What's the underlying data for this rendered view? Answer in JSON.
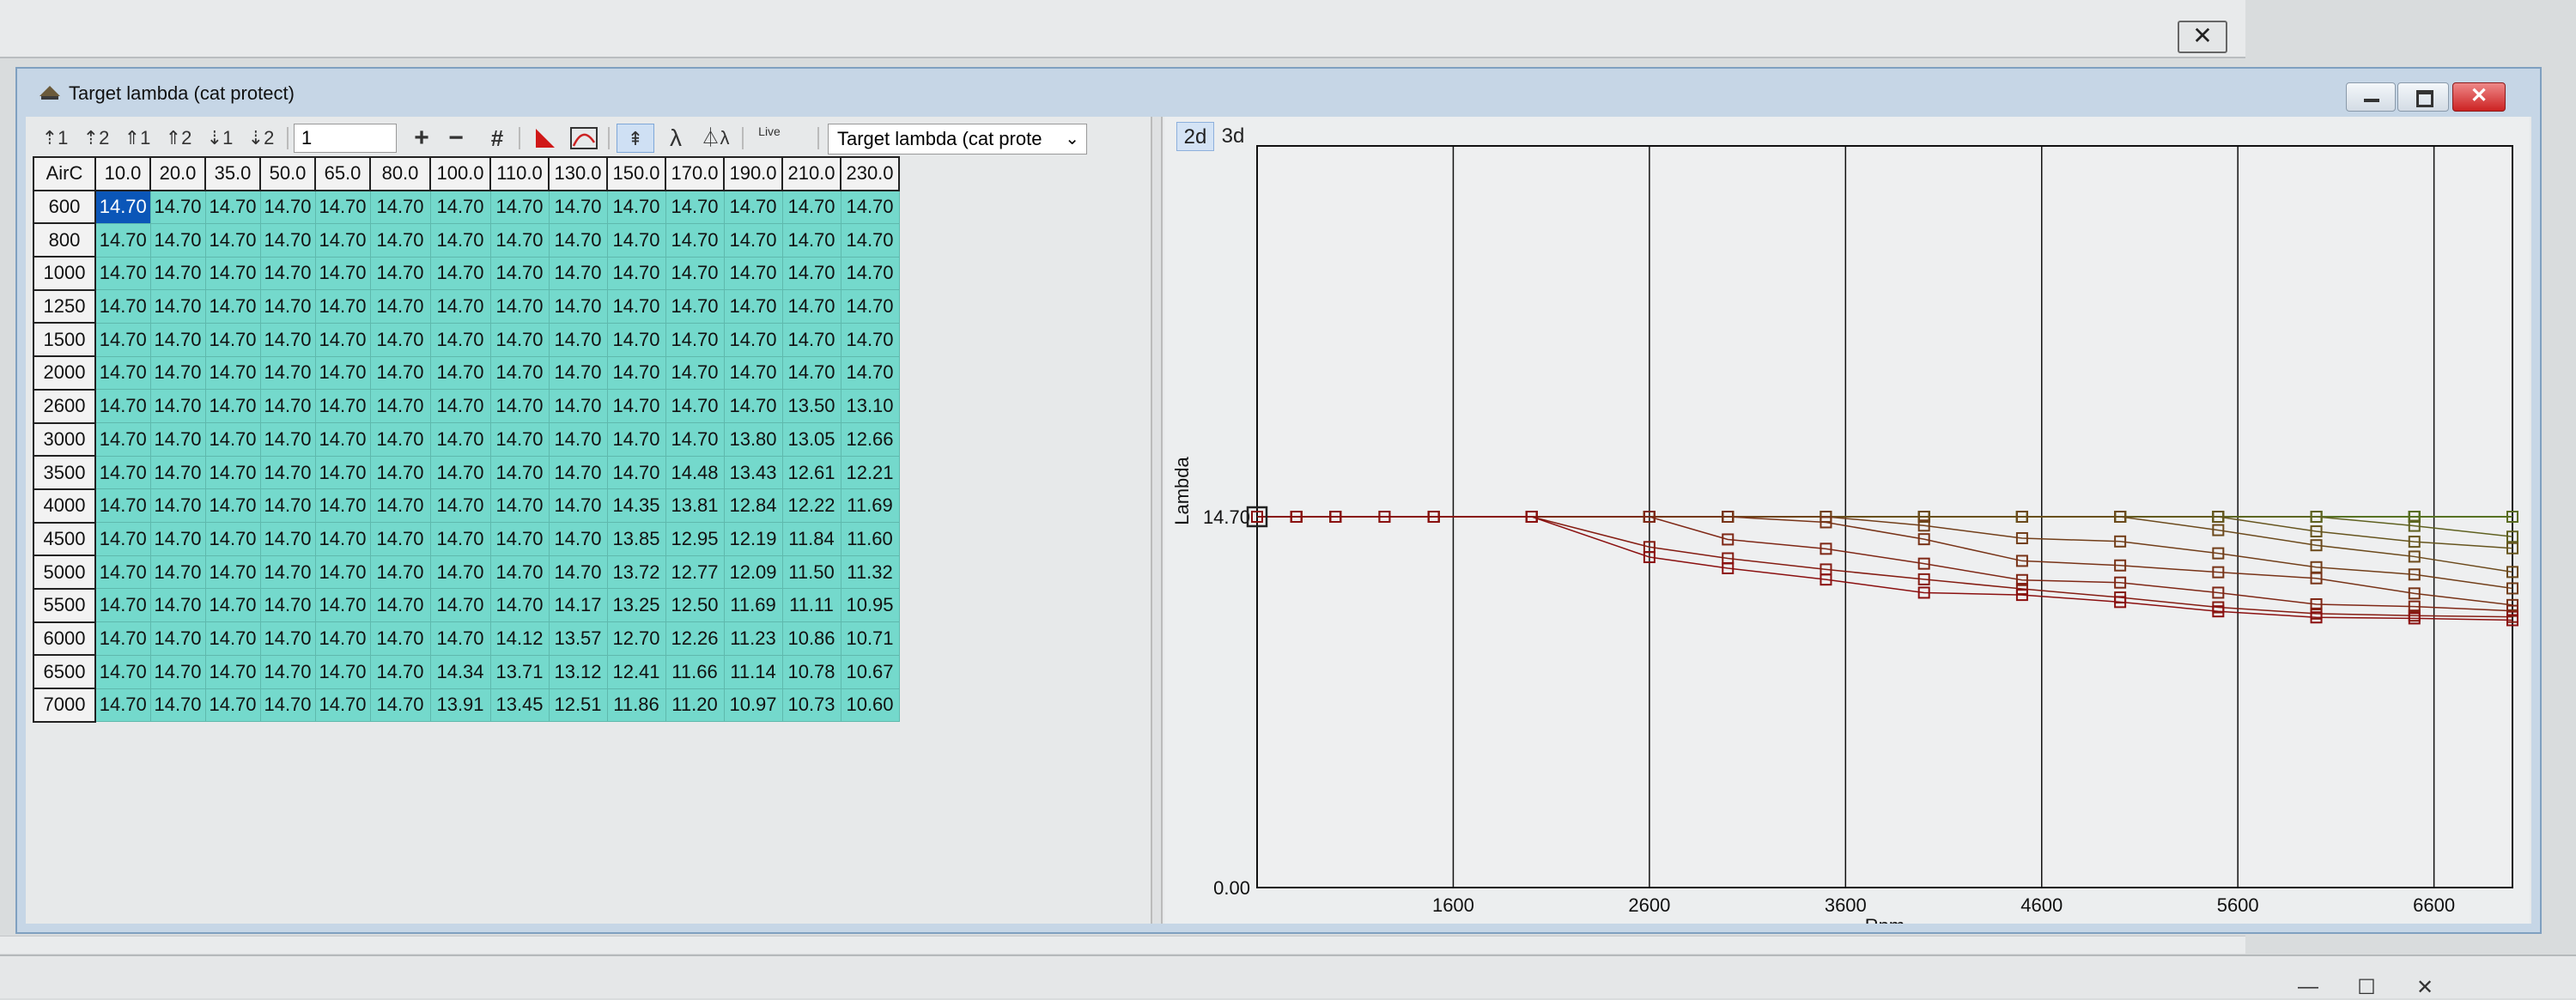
{
  "window": {
    "title": "Target lambda (cat protect)",
    "close_glyph": "✕"
  },
  "background_window": {
    "close_glyph": "✕",
    "min_glyph": "—",
    "max_glyph": "☐",
    "close2_glyph": "✕"
  },
  "toolbar": {
    "items": [
      {
        "name": "axis1-up-icon",
        "glyph": "⇡1"
      },
      {
        "name": "axis2-up-icon",
        "glyph": "⇡2"
      },
      {
        "name": "axis1-arrow-icon",
        "glyph": "⇑1"
      },
      {
        "name": "axis2-arrow-icon",
        "glyph": "⇑2"
      },
      {
        "name": "axis1-down-icon",
        "glyph": "⇣1"
      },
      {
        "name": "axis2-down-icon",
        "glyph": "⇣2"
      }
    ],
    "step_value": "1",
    "plus_glyph": "+",
    "minus_glyph": "−",
    "hash_glyph": "#",
    "lambda_glyph": "λ",
    "lambda2_glyph": "⏃λ",
    "live_label": "Live",
    "map_select": "Target lambda (cat prote"
  },
  "table": {
    "corner": "AirC",
    "columns": [
      "10.0",
      "20.0",
      "35.0",
      "50.0",
      "65.0",
      "80.0",
      "100.0",
      "110.0",
      "130.0",
      "150.0",
      "170.0",
      "190.0",
      "210.0",
      "230.0"
    ],
    "rows": [
      {
        "rpm": "600",
        "values": [
          "14.70",
          "14.70",
          "14.70",
          "14.70",
          "14.70",
          "14.70",
          "14.70",
          "14.70",
          "14.70",
          "14.70",
          "14.70",
          "14.70",
          "14.70",
          "14.70"
        ]
      },
      {
        "rpm": "800",
        "values": [
          "14.70",
          "14.70",
          "14.70",
          "14.70",
          "14.70",
          "14.70",
          "14.70",
          "14.70",
          "14.70",
          "14.70",
          "14.70",
          "14.70",
          "14.70",
          "14.70"
        ]
      },
      {
        "rpm": "1000",
        "values": [
          "14.70",
          "14.70",
          "14.70",
          "14.70",
          "14.70",
          "14.70",
          "14.70",
          "14.70",
          "14.70",
          "14.70",
          "14.70",
          "14.70",
          "14.70",
          "14.70"
        ]
      },
      {
        "rpm": "1250",
        "values": [
          "14.70",
          "14.70",
          "14.70",
          "14.70",
          "14.70",
          "14.70",
          "14.70",
          "14.70",
          "14.70",
          "14.70",
          "14.70",
          "14.70",
          "14.70",
          "14.70"
        ]
      },
      {
        "rpm": "1500",
        "values": [
          "14.70",
          "14.70",
          "14.70",
          "14.70",
          "14.70",
          "14.70",
          "14.70",
          "14.70",
          "14.70",
          "14.70",
          "14.70",
          "14.70",
          "14.70",
          "14.70"
        ]
      },
      {
        "rpm": "2000",
        "values": [
          "14.70",
          "14.70",
          "14.70",
          "14.70",
          "14.70",
          "14.70",
          "14.70",
          "14.70",
          "14.70",
          "14.70",
          "14.70",
          "14.70",
          "14.70",
          "14.70"
        ]
      },
      {
        "rpm": "2600",
        "values": [
          "14.70",
          "14.70",
          "14.70",
          "14.70",
          "14.70",
          "14.70",
          "14.70",
          "14.70",
          "14.70",
          "14.70",
          "14.70",
          "14.70",
          "13.50",
          "13.10"
        ]
      },
      {
        "rpm": "3000",
        "values": [
          "14.70",
          "14.70",
          "14.70",
          "14.70",
          "14.70",
          "14.70",
          "14.70",
          "14.70",
          "14.70",
          "14.70",
          "14.70",
          "13.80",
          "13.05",
          "12.66"
        ]
      },
      {
        "rpm": "3500",
        "values": [
          "14.70",
          "14.70",
          "14.70",
          "14.70",
          "14.70",
          "14.70",
          "14.70",
          "14.70",
          "14.70",
          "14.70",
          "14.48",
          "13.43",
          "12.61",
          "12.21"
        ]
      },
      {
        "rpm": "4000",
        "values": [
          "14.70",
          "14.70",
          "14.70",
          "14.70",
          "14.70",
          "14.70",
          "14.70",
          "14.70",
          "14.70",
          "14.35",
          "13.81",
          "12.84",
          "12.22",
          "11.69"
        ]
      },
      {
        "rpm": "4500",
        "values": [
          "14.70",
          "14.70",
          "14.70",
          "14.70",
          "14.70",
          "14.70",
          "14.70",
          "14.70",
          "14.70",
          "13.85",
          "12.95",
          "12.19",
          "11.84",
          "11.60"
        ]
      },
      {
        "rpm": "5000",
        "values": [
          "14.70",
          "14.70",
          "14.70",
          "14.70",
          "14.70",
          "14.70",
          "14.70",
          "14.70",
          "14.70",
          "13.72",
          "12.77",
          "12.09",
          "11.50",
          "11.32"
        ]
      },
      {
        "rpm": "5500",
        "values": [
          "14.70",
          "14.70",
          "14.70",
          "14.70",
          "14.70",
          "14.70",
          "14.70",
          "14.70",
          "14.17",
          "13.25",
          "12.50",
          "11.69",
          "11.11",
          "10.95"
        ]
      },
      {
        "rpm": "6000",
        "values": [
          "14.70",
          "14.70",
          "14.70",
          "14.70",
          "14.70",
          "14.70",
          "14.70",
          "14.12",
          "13.57",
          "12.70",
          "12.26",
          "11.23",
          "10.86",
          "10.71"
        ]
      },
      {
        "rpm": "6500",
        "values": [
          "14.70",
          "14.70",
          "14.70",
          "14.70",
          "14.70",
          "14.70",
          "14.34",
          "13.71",
          "13.12",
          "12.41",
          "11.66",
          "11.14",
          "10.78",
          "10.67"
        ]
      },
      {
        "rpm": "7000",
        "values": [
          "14.70",
          "14.70",
          "14.70",
          "14.70",
          "14.70",
          "14.70",
          "13.91",
          "13.45",
          "12.51",
          "11.86",
          "11.20",
          "10.97",
          "10.73",
          "10.60"
        ]
      }
    ]
  },
  "view_tabs": {
    "tab_2d": "2d",
    "tab_3d": "3d"
  },
  "chart_data": {
    "type": "line",
    "xlabel": "Rpm",
    "ylabel": "Lambda",
    "xlim": [
      600,
      7000
    ],
    "ylim": [
      0,
      29.4
    ],
    "xticks": [
      "1600",
      "2600",
      "3600",
      "4600",
      "5600",
      "6600"
    ],
    "yticks": [
      "0.00",
      "14.70"
    ],
    "x": [
      600,
      800,
      1000,
      1250,
      1500,
      2000,
      2600,
      3000,
      3500,
      4000,
      4500,
      5000,
      5500,
      6000,
      6500,
      7000
    ],
    "colors": {
      "grid": "#111111",
      "low": "#3aa62e",
      "high": "#8b1010"
    }
  }
}
